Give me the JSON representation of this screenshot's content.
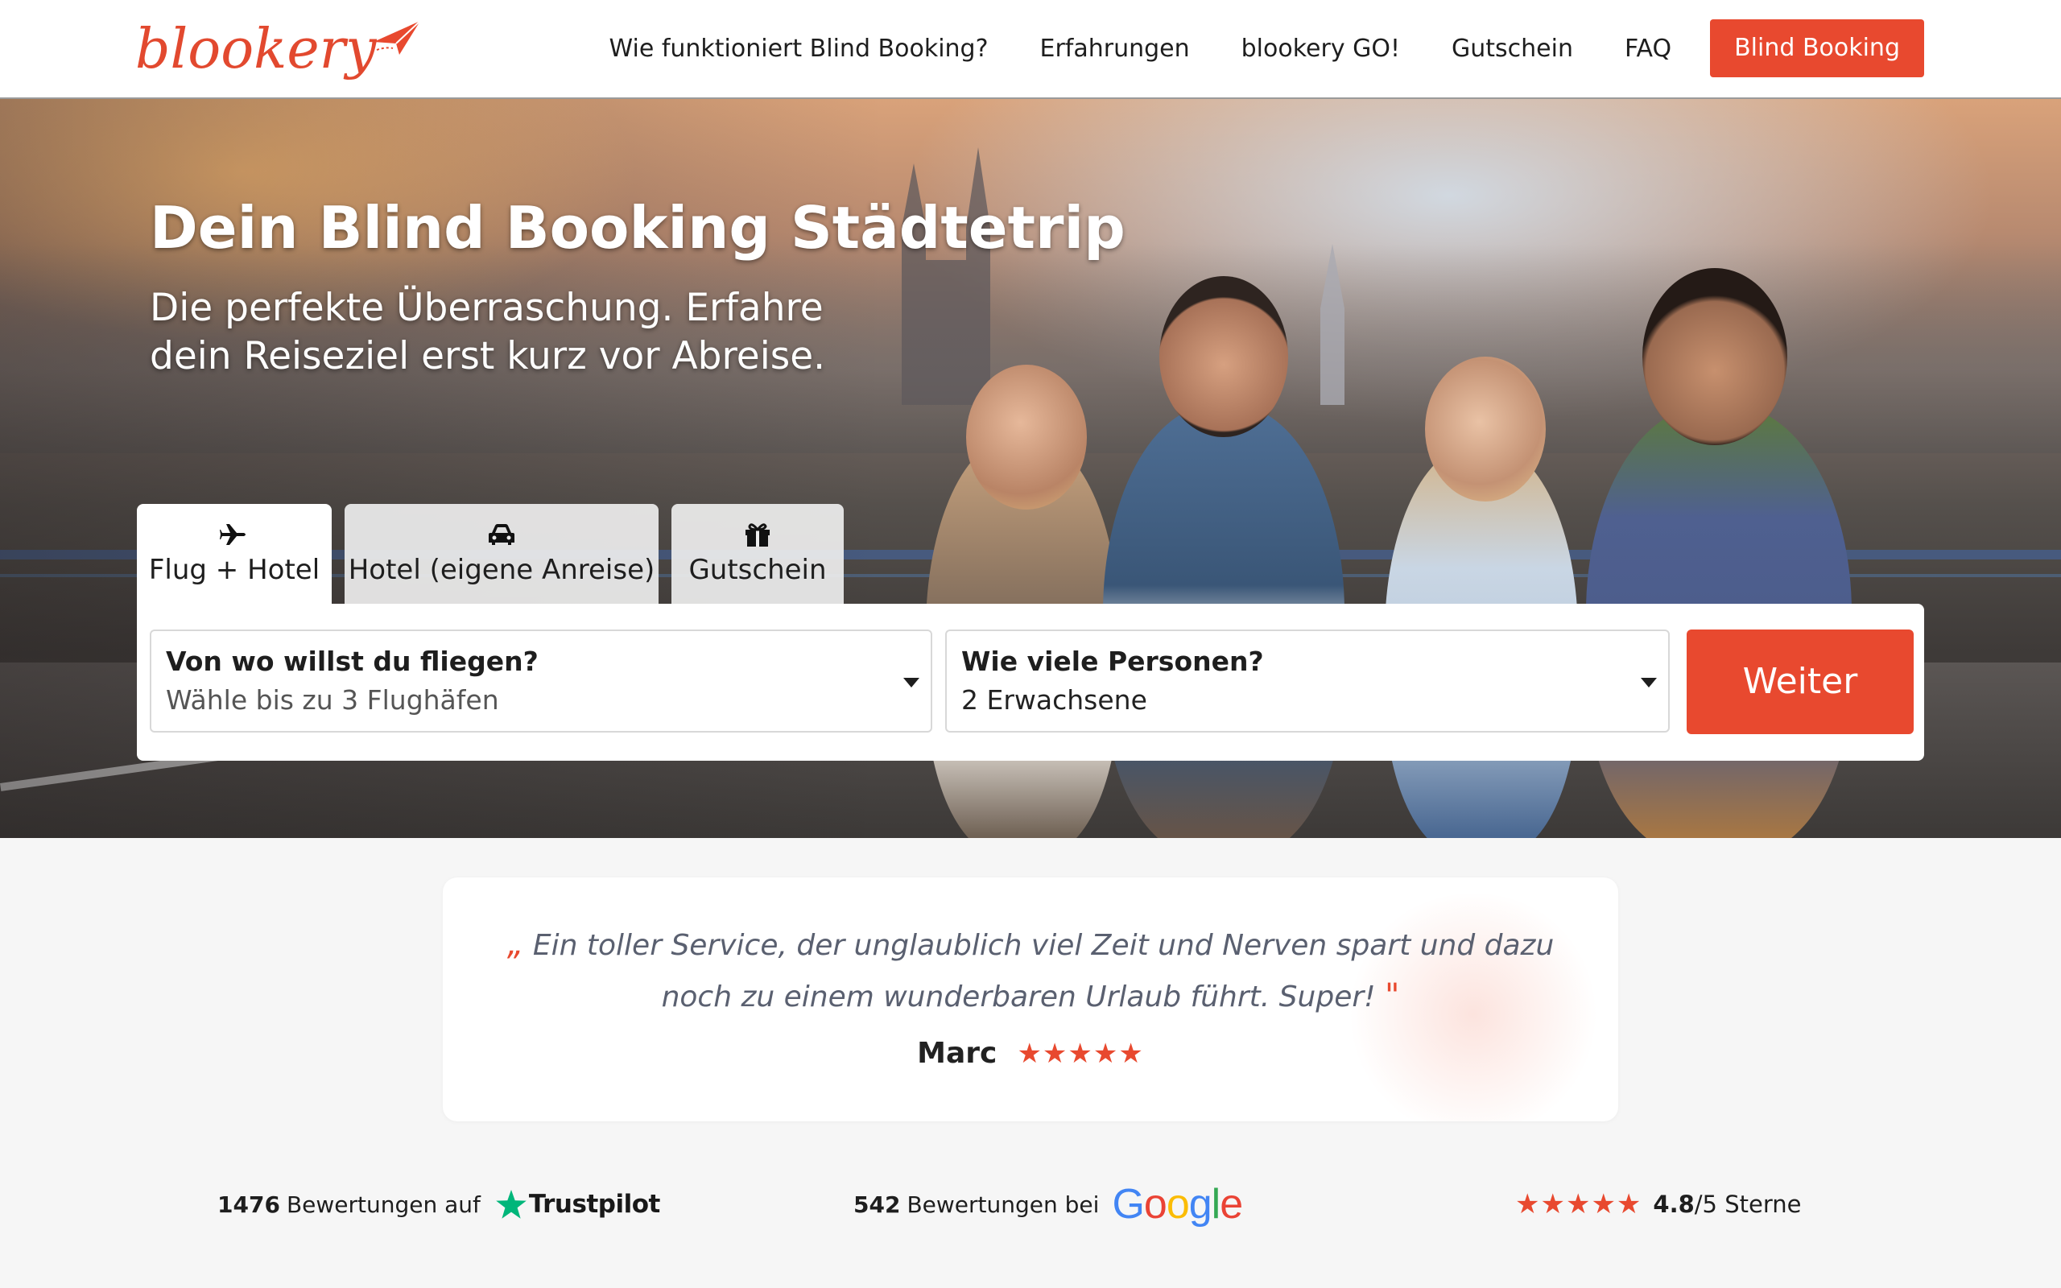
{
  "brand": {
    "name": "blookery",
    "color": "#e8492f"
  },
  "nav": {
    "links": [
      "Wie funktioniert Blind Booking?",
      "Erfahrungen",
      "blookery GO!",
      "Gutschein",
      "FAQ"
    ],
    "cta": "Blind Booking"
  },
  "hero": {
    "title": "Dein Blind Booking Städtetrip",
    "subtitle_line1": "Die perfekte Überraschung. Erfahre",
    "subtitle_line2": "dein Reiseziel erst kurz vor Abreise."
  },
  "tabs": [
    {
      "label": "Flug + Hotel",
      "icon": "plane-icon",
      "active": true
    },
    {
      "label": "Hotel (eigene Anreise)",
      "icon": "car-icon",
      "active": false
    },
    {
      "label": "Gutschein",
      "icon": "gift-icon",
      "active": false
    }
  ],
  "search": {
    "origin": {
      "label": "Von wo willst du fliegen?",
      "value": "Wähle bis zu 3 Flughäfen"
    },
    "persons": {
      "label": "Wie viele Personen?",
      "value": "2 Erwachsene"
    },
    "submit": "Weiter"
  },
  "testimonial": {
    "open_quote": "„",
    "text": "Ein toller Service, der unglaublich viel Zeit und Nerven spart und dazu noch zu einem wunderbaren Urlaub führt. Super!",
    "close_quote": "\"",
    "author": "Marc",
    "stars": "★★★★★"
  },
  "ratings": {
    "trustpilot": {
      "count": "1476",
      "text": "Bewertungen auf",
      "logo": "Trustpilot"
    },
    "google": {
      "count": "542",
      "text": "Bewertungen bei",
      "logo_letters": [
        "G",
        "o",
        "o",
        "g",
        "l",
        "e"
      ]
    },
    "score": {
      "stars": "★★★★★",
      "value": "4.8",
      "suffix": "/5 Sterne"
    }
  }
}
